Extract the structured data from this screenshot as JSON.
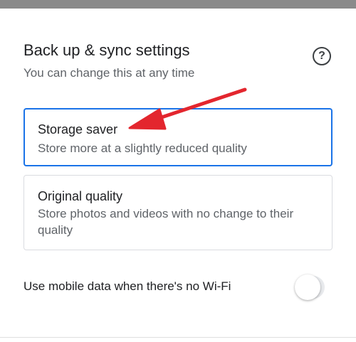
{
  "header": {
    "title": "Back up & sync settings",
    "subtitle": "You can change this at any time",
    "help_icon": "help-circle-icon"
  },
  "options": [
    {
      "title": "Storage saver",
      "description": "Store more at a slightly reduced quality",
      "selected": true
    },
    {
      "title": "Original quality",
      "description": "Store photos and videos with no change to their quality",
      "selected": false
    }
  ],
  "mobile_data": {
    "label": "Use mobile data when there's no Wi-Fi",
    "enabled": false
  },
  "colors": {
    "selected_border": "#1a73e8",
    "annotation_arrow": "#e3262e",
    "top_bar": "#8a8a8a"
  }
}
